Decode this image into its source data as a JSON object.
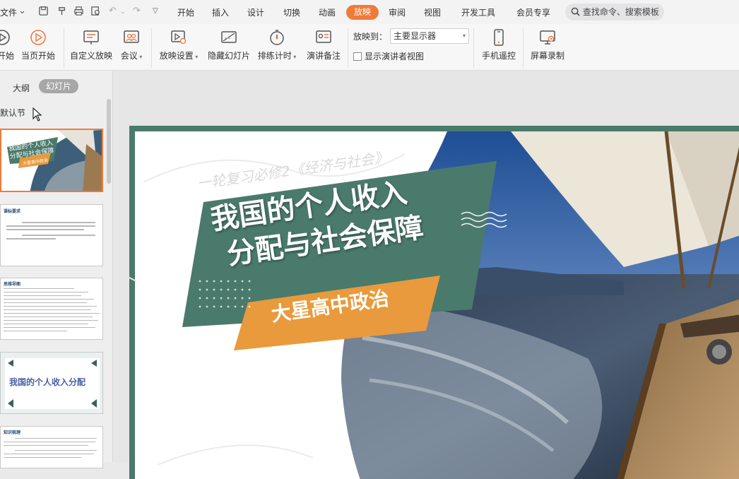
{
  "menu": {
    "file": "文件",
    "tabs": [
      "开始",
      "插入",
      "设计",
      "切换",
      "动画",
      "放映",
      "审阅",
      "视图",
      "开发工具",
      "会员专享"
    ],
    "active_tab": "放映",
    "search_placeholder": "查找命令、搜索模板"
  },
  "ribbon": {
    "from_start": "开始",
    "from_current": "当页开始",
    "custom_show": "自定义放映",
    "meeting": "会议",
    "show_settings": "放映设置",
    "hide_slide": "隐藏幻灯片",
    "rehearse": "排练计时",
    "speaker_notes": "演讲备注",
    "show_on_label": "放映到：",
    "show_on_value": "主要显示器",
    "presenter_view": "显示演讲者视图",
    "phone_remote": "手机遥控",
    "screen_record": "屏幕录制"
  },
  "sidebar": {
    "tab_outline": "大纲",
    "tab_slides": "幻灯片",
    "section_name": "默认节",
    "thumb1_title_line1": "我国的个人收入",
    "thumb1_title_line2": "分配与社会保障",
    "thumb1_sub": "大星高中政治",
    "thumb2_heading": "课标要求",
    "thumb3_heading": "思维导图",
    "thumb4_title": "我国的个人收入分配",
    "thumb5_heading": "知识梳理"
  },
  "slide": {
    "top_subtitle": "一轮复习必修2《经济与社会》",
    "title_line1": "我国的个人收入",
    "title_line2": "分配与社会保障",
    "school": "大星高中政治"
  },
  "colors": {
    "accent": "#ee7b3a",
    "slide_green": "#4a7a6c",
    "banner_orange": "#e99a3c"
  }
}
